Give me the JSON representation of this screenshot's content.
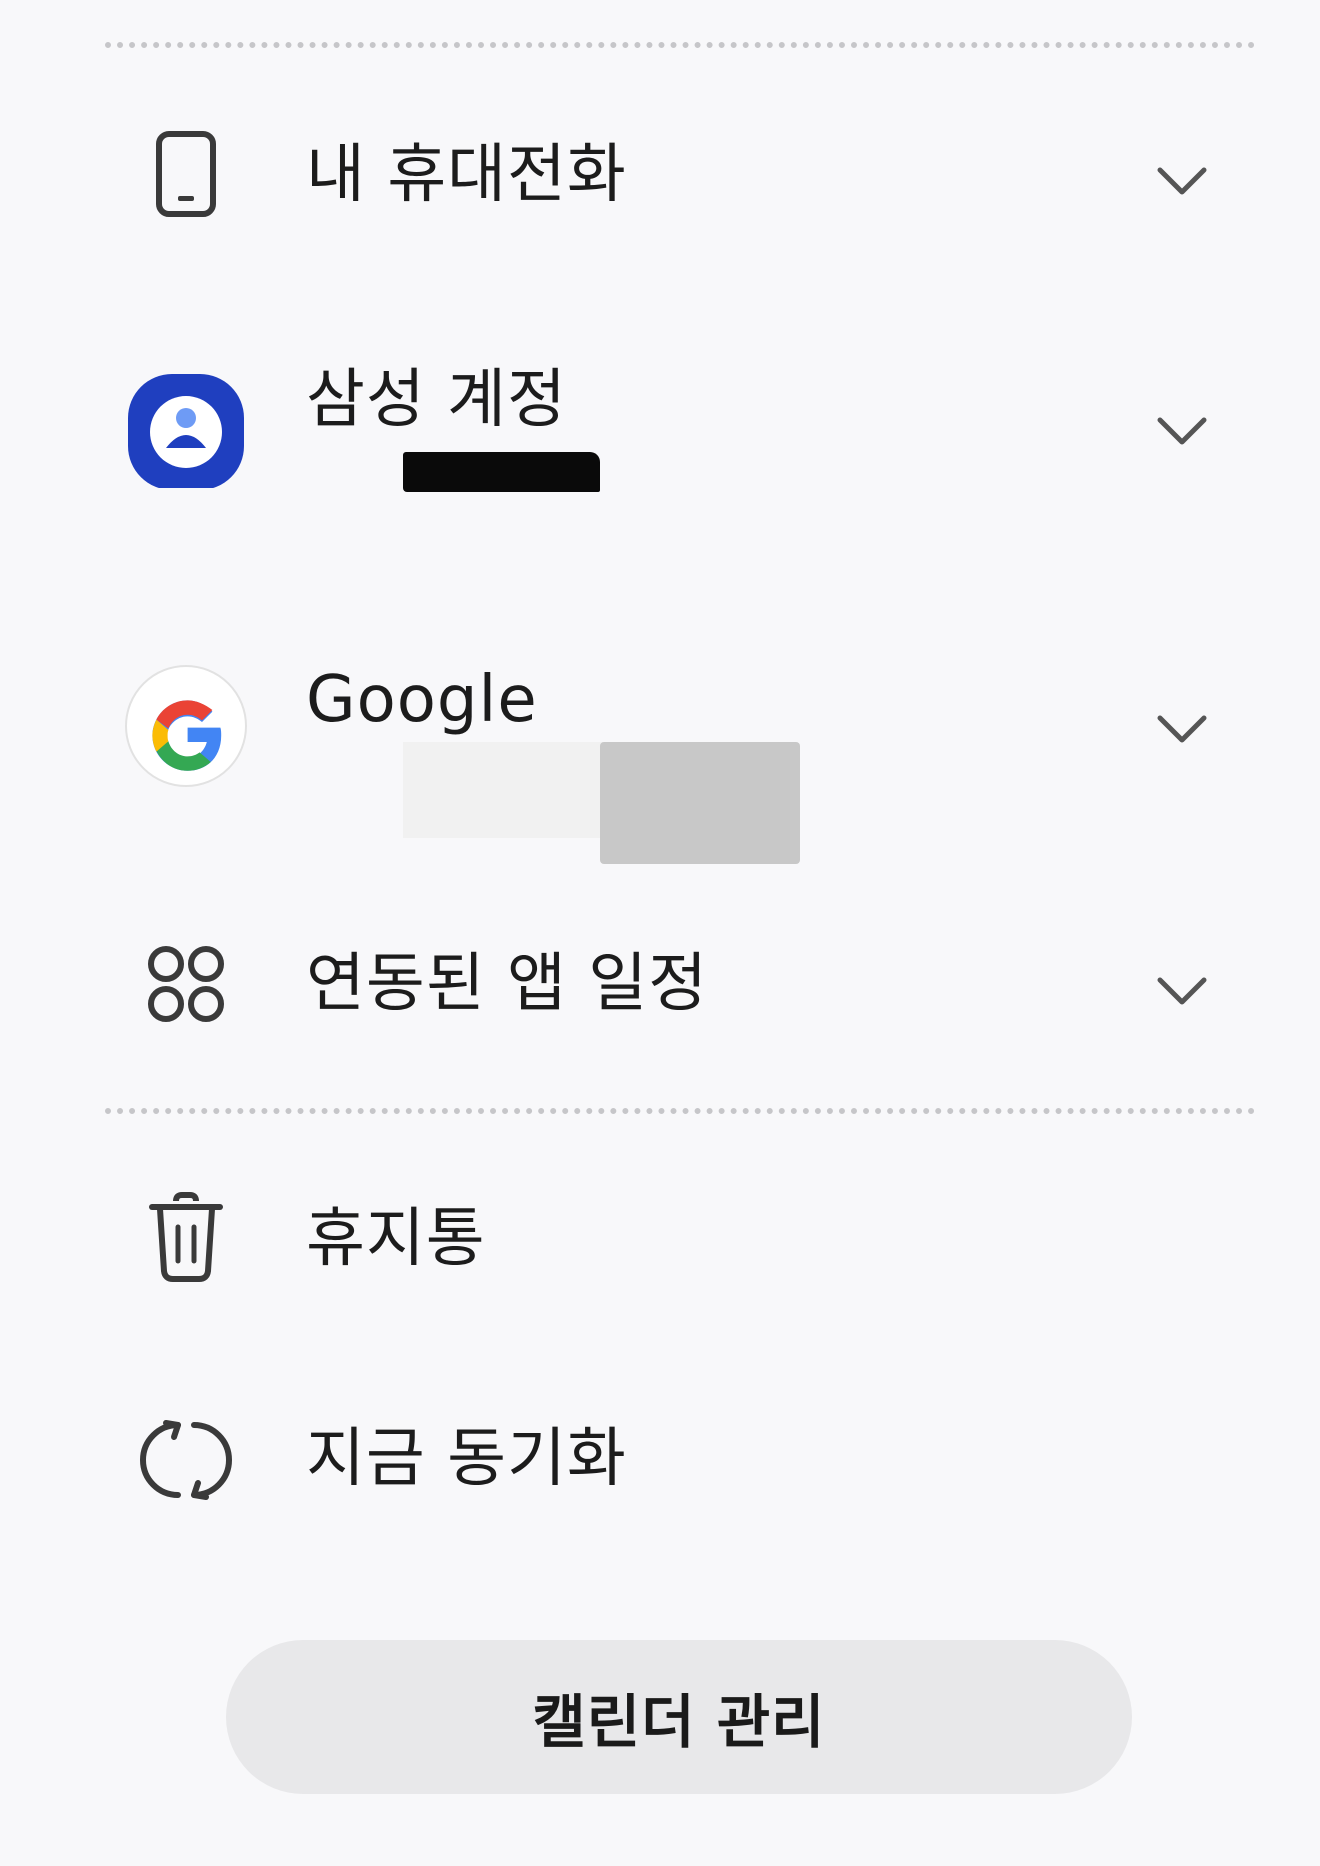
{
  "drawer": {
    "items": [
      {
        "label": "내 휴대전화",
        "icon": "phone-icon",
        "expandable": true
      },
      {
        "label": "삼성 계정",
        "icon": "samsung-account-icon",
        "expandable": true
      },
      {
        "label": "Google",
        "icon": "google-icon",
        "expandable": true
      },
      {
        "label": "연동된 앱 일정",
        "icon": "apps-icon",
        "expandable": true
      },
      {
        "label": "휴지통",
        "icon": "trash-icon",
        "expandable": false
      },
      {
        "label": "지금 동기화",
        "icon": "sync-icon",
        "expandable": false
      }
    ],
    "manage_button_label": "캘린더 관리"
  },
  "colors": {
    "background": "#f8f8fa",
    "divider": "#c6c6c9",
    "samsung_blue": "#1f3fbf",
    "button_bg": "#e8e8ea",
    "google_blue": "#4285F4",
    "google_red": "#EA4335",
    "google_yellow": "#FBBC05",
    "google_green": "#34A853"
  }
}
